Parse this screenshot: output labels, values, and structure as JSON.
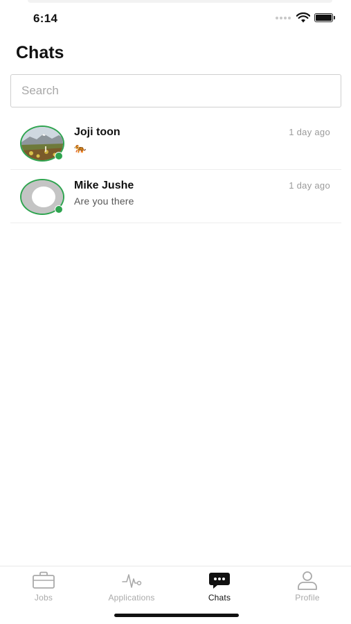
{
  "status_bar": {
    "time": "6:14",
    "icons": [
      "signal-dots-icon",
      "wifi-icon",
      "battery-icon"
    ]
  },
  "header": {
    "title": "Chats"
  },
  "search": {
    "placeholder": "Search",
    "value": ""
  },
  "chats": [
    {
      "name": "Joji toon",
      "preview": "🐅",
      "time": "1 day ago",
      "avatar": "mountain-photo",
      "online": true
    },
    {
      "name": "Mike Jushe",
      "preview": "Are you there",
      "time": "1 day ago",
      "avatar": "default-avatar",
      "online": true
    }
  ],
  "tab_bar": {
    "items": [
      {
        "label": "Jobs",
        "icon": "briefcase-icon",
        "active": false
      },
      {
        "label": "Applications",
        "icon": "activity-icon",
        "active": false
      },
      {
        "label": "Chats",
        "icon": "chat-bubble-icon",
        "active": true
      },
      {
        "label": "Profile",
        "icon": "person-icon",
        "active": false
      }
    ]
  },
  "colors": {
    "online": "#2ea44f",
    "inactive_tab": "#a9a9a9",
    "active_tab": "#111111",
    "text_secondary": "#555555",
    "timestamp": "#9a9a9a"
  }
}
